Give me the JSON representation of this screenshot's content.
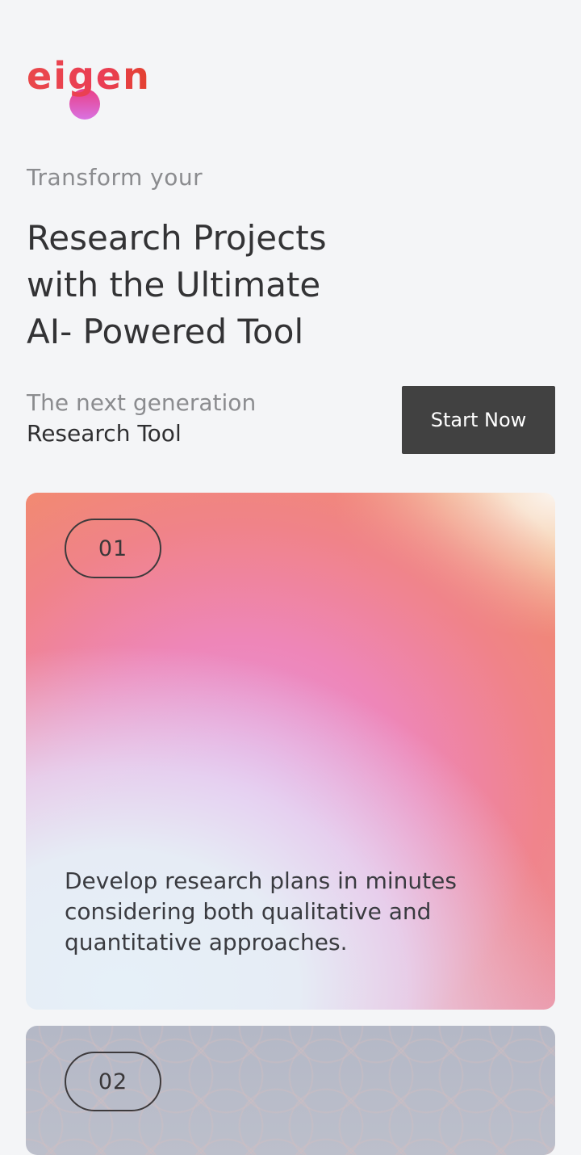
{
  "brand": {
    "logo_text": "eigen",
    "colors": {
      "logo_primary": "#e8443a",
      "logo_dot": "#de5fc4",
      "button_bg": "#414141",
      "page_bg": "#f4f5f7"
    }
  },
  "hero": {
    "eyebrow": "Transform your",
    "headline_lines": [
      "Research Projects",
      "with the Ultimate",
      "AI- Powered Tool"
    ],
    "sub_line_1": "The next generation",
    "sub_line_2": "Research Tool",
    "cta_label": "Start Now"
  },
  "cards": [
    {
      "number": "01",
      "text": "Develop research plans in minutes considering both qualitative and quantitative approaches."
    },
    {
      "number": "02"
    }
  ]
}
